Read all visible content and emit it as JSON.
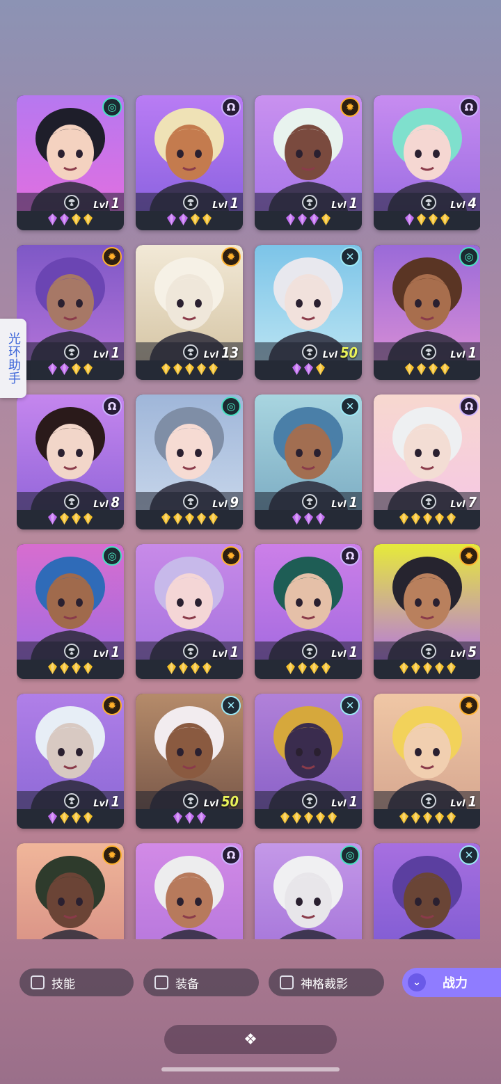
{
  "side_tab": {
    "label": "光环助手"
  },
  "filters": [
    {
      "label": "技能",
      "checked": false
    },
    {
      "label": "装备",
      "checked": false
    },
    {
      "label": "神格裁影",
      "checked": false
    }
  ],
  "sort_button": {
    "label": "战力",
    "icon": "double-chevron-down-icon"
  },
  "bottom_bar": {
    "icon": "grid-collapse-icon",
    "glyph": "❖"
  },
  "level_prefix": "Lvl",
  "colors": {
    "gem_purple": "#c06cf0",
    "gem_gold": "#f4c12b",
    "level_highlight": "#e9f25a",
    "card_bg": "#252a36",
    "accent": "#8f7cff"
  },
  "heroes": [
    {
      "name": "hero-baseball-cap-girl",
      "level": "1",
      "faction": "teal",
      "faction_icon": "spiral-icon",
      "gems": [
        "purple",
        "purple",
        "gold",
        "gold"
      ],
      "bg": [
        "#b678f0",
        "#e06fe0"
      ],
      "skin": "#f4d2c0",
      "hair": "#1e1e2a"
    },
    {
      "name": "hero-winking-blonde",
      "level": "1",
      "faction": "purple",
      "faction_icon": "omega-icon",
      "gems": [
        "purple",
        "purple",
        "gold",
        "gold"
      ],
      "bg": [
        "#b97cf4",
        "#8c63e0"
      ],
      "skin": "#c47b4e",
      "hair": "#efe2b6"
    },
    {
      "name": "hero-masked-ninja",
      "level": "1",
      "faction": "orange",
      "faction_icon": "sun-icon",
      "gems": [
        "purple",
        "purple",
        "purple",
        "gold"
      ],
      "bg": [
        "#c991ef",
        "#a876e9"
      ],
      "skin": "#7a4a3e",
      "hair": "#e8f3ee"
    },
    {
      "name": "hero-mint-hair-lady",
      "level": "4",
      "faction": "purple",
      "faction_icon": "omega-icon",
      "gems": [
        "purple",
        "gold",
        "gold",
        "gold"
      ],
      "bg": [
        "#c78cf0",
        "#9d6ee3"
      ],
      "skin": "#f5d7d2",
      "hair": "#7fe0cd"
    },
    {
      "name": "hero-purple-haired-man",
      "level": "1",
      "faction": "orange",
      "faction_icon": "sun-icon",
      "gems": [
        "purple",
        "purple",
        "gold",
        "gold"
      ],
      "bg": [
        "#7e58c6",
        "#b172d8"
      ],
      "skin": "#a77866",
      "hair": "#6b45b3"
    },
    {
      "name": "hero-white-lion",
      "level": "13",
      "faction": "orange",
      "faction_icon": "sun-icon",
      "gems": [
        "gold",
        "gold",
        "gold",
        "gold",
        "gold"
      ],
      "bg": [
        "#f2e9d7",
        "#d6c6a6"
      ],
      "skin": "#efe7da",
      "hair": "#f6f1e6"
    },
    {
      "name": "hero-pale-red-haired",
      "level": "50",
      "level_highlight": true,
      "faction": "cyan",
      "faction_icon": "cross-icon",
      "gems": [
        "purple",
        "purple",
        "gold"
      ],
      "bg": [
        "#7cc4e8",
        "#b8e3f2"
      ],
      "skin": "#f1e1dc",
      "hair": "#e8e8ee"
    },
    {
      "name": "hero-horned-goggles",
      "level": "1",
      "faction": "teal",
      "faction_icon": "spiral-icon",
      "gems": [
        "gold",
        "gold",
        "gold",
        "gold"
      ],
      "bg": [
        "#9a6ad8",
        "#d58cd6"
      ],
      "skin": "#a86e4d",
      "hair": "#5a3524"
    },
    {
      "name": "hero-red-top-hat",
      "level": "8",
      "faction": "purple",
      "faction_icon": "omega-icon",
      "gems": [
        "purple",
        "gold",
        "gold",
        "gold"
      ],
      "bg": [
        "#c586ee",
        "#9467da"
      ],
      "skin": "#f2d6c9",
      "hair": "#2a1a1a"
    },
    {
      "name": "hero-grey-haired-girl",
      "level": "9",
      "faction": "teal",
      "faction_icon": "spiral-icon",
      "gems": [
        "gold",
        "gold",
        "gold",
        "gold",
        "gold"
      ],
      "bg": [
        "#9fb6d9",
        "#c6d5ea"
      ],
      "skin": "#f6dbd3",
      "hair": "#7f8ea6"
    },
    {
      "name": "hero-blue-dreads-man",
      "level": "1",
      "faction": "cyan",
      "faction_icon": "cross-icon",
      "gems": [
        "purple",
        "purple",
        "purple"
      ],
      "bg": [
        "#a8d5e0",
        "#7eaec4"
      ],
      "skin": "#a26e51",
      "hair": "#4a7fa8"
    },
    {
      "name": "hero-white-curly-woman",
      "level": "7",
      "faction": "purple",
      "faction_icon": "omega-icon",
      "gems": [
        "gold",
        "gold",
        "gold",
        "gold",
        "gold"
      ],
      "bg": [
        "#f7d8cf",
        "#f6c8e3"
      ],
      "skin": "#f3ddd4",
      "hair": "#eef0f2"
    },
    {
      "name": "hero-blue-braids-glasses",
      "level": "1",
      "faction": "teal",
      "faction_icon": "spiral-icon",
      "gems": [
        "gold",
        "gold",
        "gold",
        "gold"
      ],
      "bg": [
        "#d76dcf",
        "#a46ce0"
      ],
      "skin": "#a06a4c",
      "hair": "#2f6bb8"
    },
    {
      "name": "hero-lavender-hair",
      "level": "1",
      "faction": "orange",
      "faction_icon": "sun-icon",
      "gems": [
        "gold",
        "gold",
        "gold",
        "gold"
      ],
      "bg": [
        "#c88ae8",
        "#a774df"
      ],
      "skin": "#f4d6d6",
      "hair": "#c7b9ea"
    },
    {
      "name": "hero-green-hood",
      "level": "1",
      "faction": "purple",
      "faction_icon": "omega-icon",
      "gems": [
        "gold",
        "gold",
        "gold",
        "gold"
      ],
      "bg": [
        "#cc7fe8",
        "#a56be0"
      ],
      "skin": "#e5c0a8",
      "hair": "#1e5d55"
    },
    {
      "name": "hero-dark-hair-yellow",
      "level": "5",
      "faction": "orange",
      "faction_icon": "sun-icon",
      "gems": [
        "gold",
        "gold",
        "gold",
        "gold",
        "gold"
      ],
      "bg": [
        "#e6ea3a",
        "#b679dc"
      ],
      "skin": "#b9805d",
      "hair": "#26242f"
    },
    {
      "name": "hero-white-bearded-elder",
      "level": "1",
      "faction": "orange",
      "faction_icon": "sun-icon",
      "gems": [
        "purple",
        "gold",
        "gold",
        "gold"
      ],
      "bg": [
        "#b07fe8",
        "#8f6ad7"
      ],
      "skin": "#d8c9c2",
      "hair": "#e7eef6"
    },
    {
      "name": "hero-white-veiled-girl",
      "level": "50",
      "level_highlight": true,
      "faction": "cyan",
      "faction_icon": "cross-icon",
      "gems": [
        "purple",
        "purple",
        "purple"
      ],
      "bg": [
        "#b58b6a",
        "#7c5a4a"
      ],
      "skin": "#8a5a40",
      "hair": "#f2ecef"
    },
    {
      "name": "hero-cat-pharaoh",
      "level": "1",
      "faction": "cyan",
      "faction_icon": "cross-icon",
      "gems": [
        "gold",
        "gold",
        "gold",
        "gold",
        "gold"
      ],
      "bg": [
        "#b181d9",
        "#8b62c8"
      ],
      "skin": "#3a2c4e",
      "hair": "#d6a83c"
    },
    {
      "name": "hero-blonde-glasses-boy",
      "level": "1",
      "faction": "orange",
      "faction_icon": "sun-icon",
      "gems": [
        "gold",
        "gold",
        "gold",
        "gold",
        "gold"
      ],
      "bg": [
        "#f0c7a5",
        "#d7a891"
      ],
      "skin": "#f1cfb0",
      "hair": "#f2d25a"
    },
    {
      "name": "hero-masked-warrior",
      "level": "",
      "faction": "orange",
      "faction_icon": "sun-icon",
      "gems": [],
      "bg": [
        "#f0b69a",
        "#d78f84"
      ],
      "skin": "#6b4436",
      "hair": "#2e3b2c"
    },
    {
      "name": "hero-black-white-hair",
      "level": "",
      "faction": "purple",
      "faction_icon": "omega-icon",
      "gems": [],
      "bg": [
        "#d28ae6",
        "#b576dc"
      ],
      "skin": "#b77a5c",
      "hair": "#ededee"
    },
    {
      "name": "hero-white-hat-grey",
      "level": "",
      "faction": "teal",
      "faction_icon": "spiral-icon",
      "gems": [],
      "bg": [
        "#c498e8",
        "#a474d9"
      ],
      "skin": "#e8e6ea",
      "hair": "#f0f0f2"
    },
    {
      "name": "hero-veiled-dark-lady",
      "level": "",
      "faction": "cyan",
      "faction_icon": "cross-icon",
      "gems": [],
      "bg": [
        "#a76fe0",
        "#7d5bd2"
      ],
      "skin": "#6a4536",
      "hair": "#5b3fa0"
    }
  ]
}
